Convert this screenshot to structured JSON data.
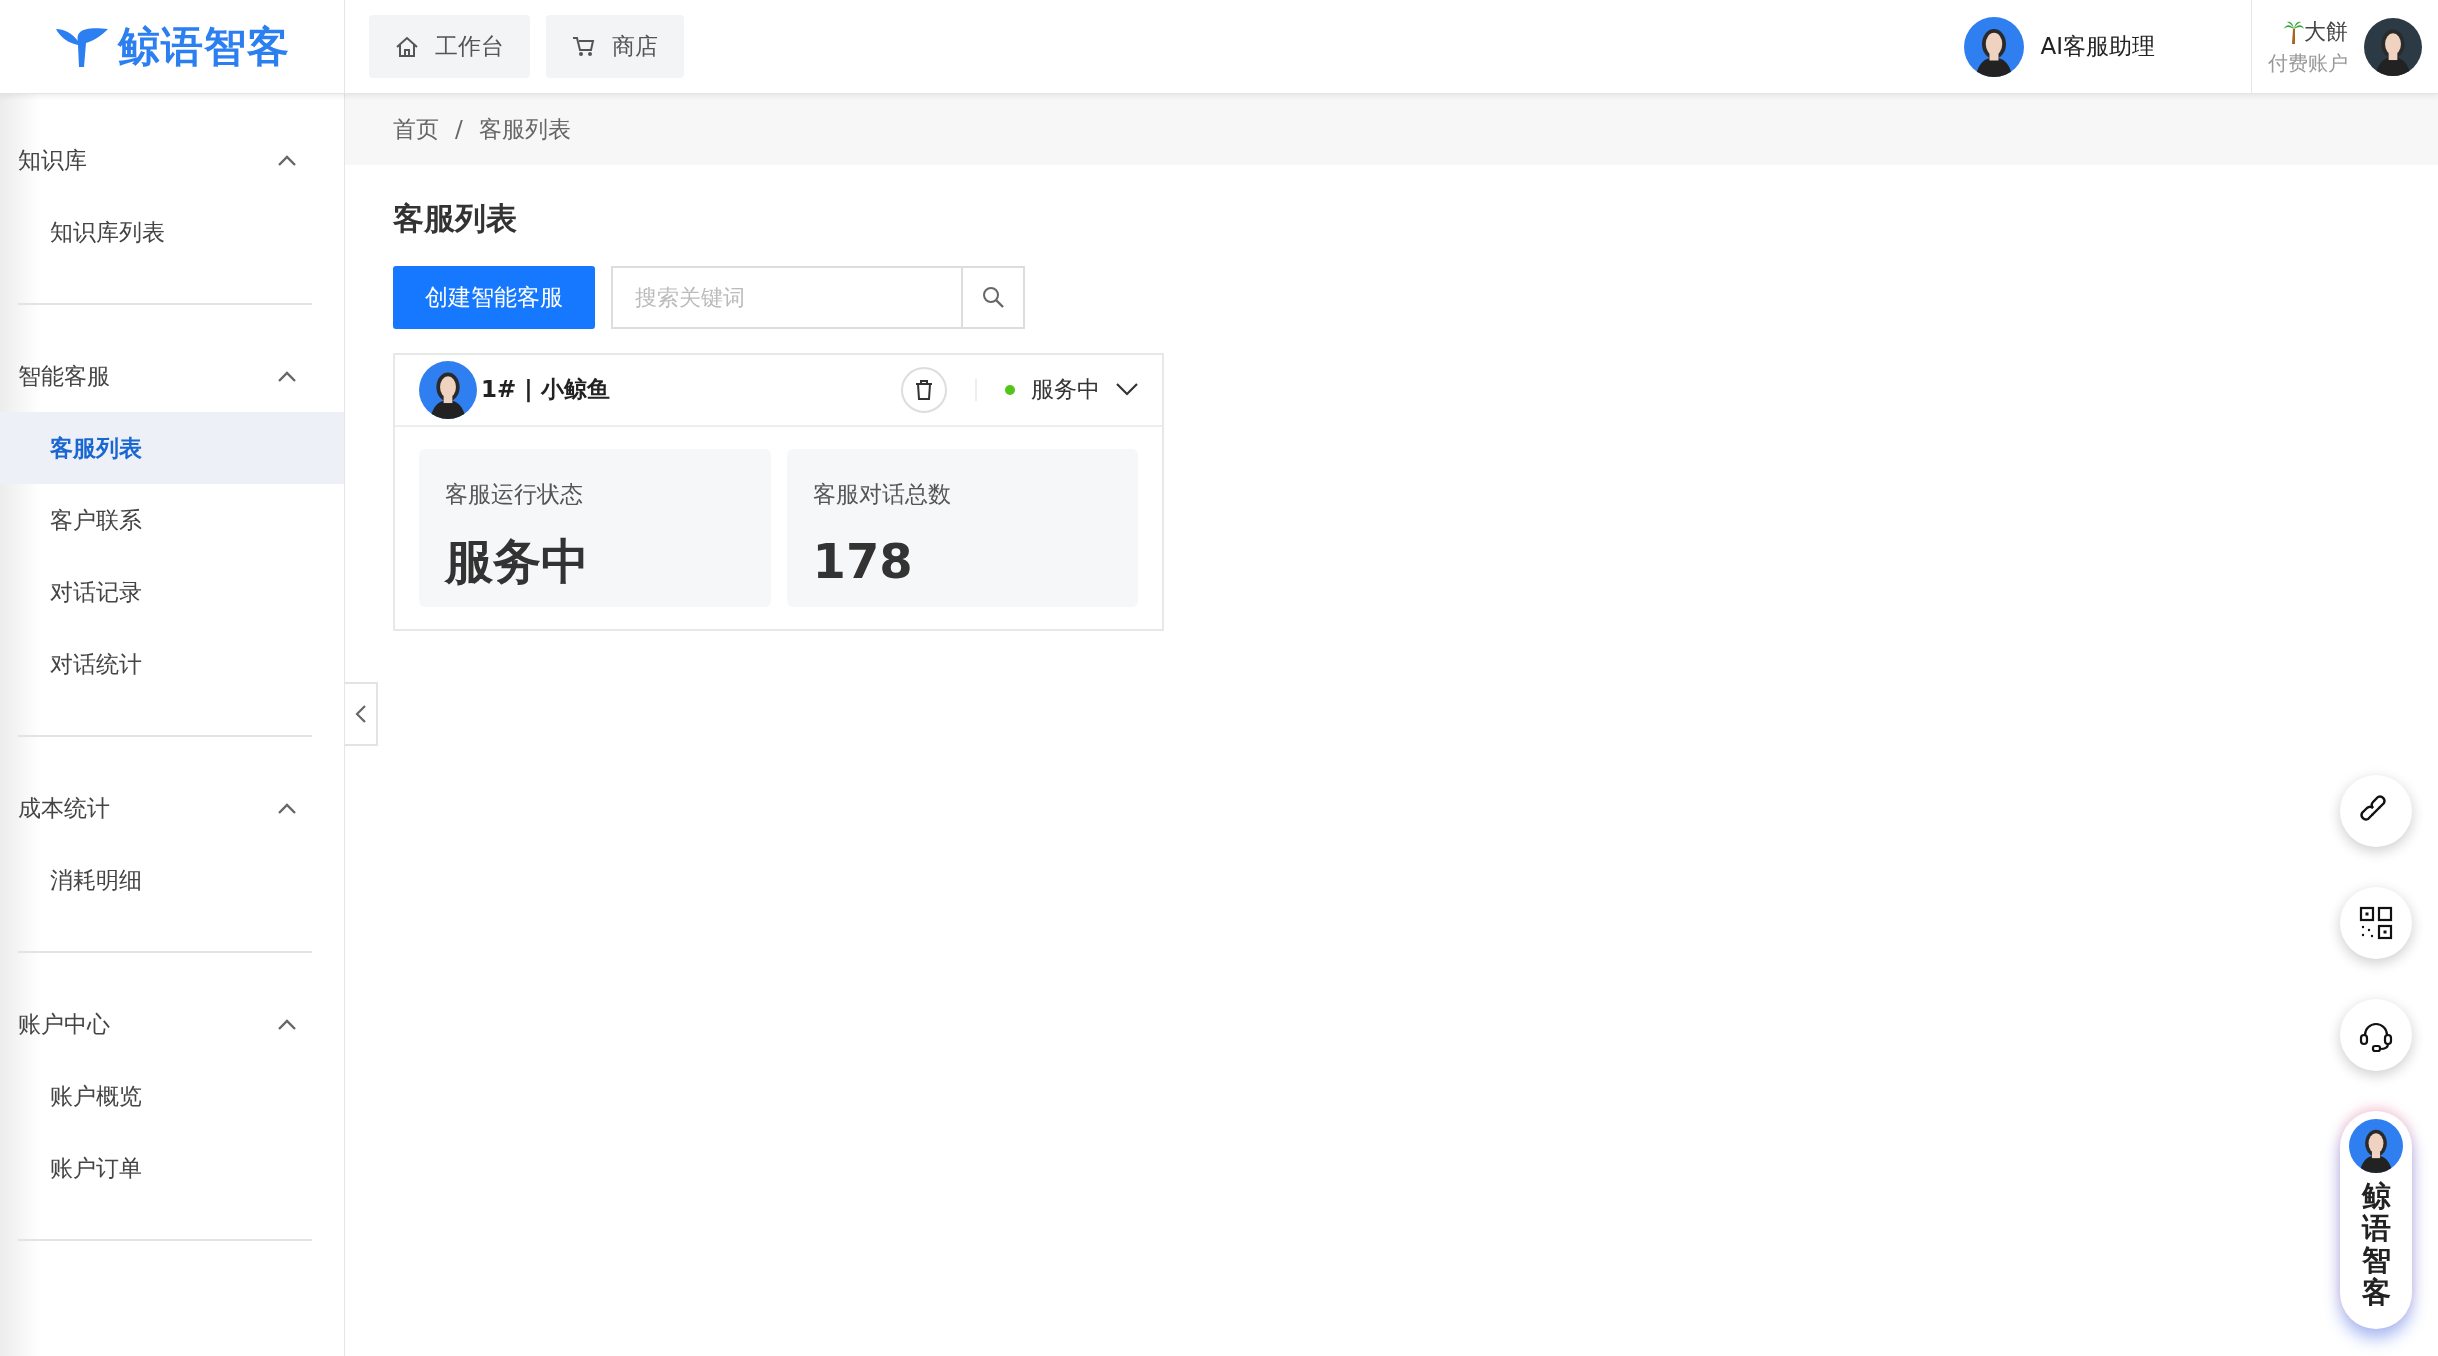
{
  "logo": {
    "text": "鲸语智客"
  },
  "top_nav": [
    {
      "label": "工作台"
    },
    {
      "label": "商店"
    }
  ],
  "assistant": {
    "label": "AI客服助理"
  },
  "user": {
    "name": "大餅",
    "plan": "付费账户"
  },
  "sidebar": {
    "groups": [
      {
        "title": "知识库",
        "expanded": true,
        "items": [
          {
            "label": "知识库列表",
            "selected": false
          }
        ]
      },
      {
        "title": "智能客服",
        "expanded": true,
        "items": [
          {
            "label": "客服列表",
            "selected": true
          },
          {
            "label": "客户联系",
            "selected": false
          },
          {
            "label": "对话记录",
            "selected": false
          },
          {
            "label": "对话统计",
            "selected": false
          }
        ]
      },
      {
        "title": "成本统计",
        "expanded": true,
        "items": [
          {
            "label": "消耗明细",
            "selected": false
          }
        ]
      },
      {
        "title": "账户中心",
        "expanded": true,
        "items": [
          {
            "label": "账户概览",
            "selected": false
          },
          {
            "label": "账户订单",
            "selected": false
          }
        ]
      }
    ]
  },
  "breadcrumb": [
    "首页",
    "客服列表"
  ],
  "breadcrumb_separator": "/",
  "page_title": "客服列表",
  "create_button": "创建智能客服",
  "search": {
    "placeholder": "搜索关键词"
  },
  "agents": [
    {
      "name": "1# | 小鲸鱼",
      "status": "服务中",
      "online": true,
      "stats": [
        {
          "label": "客服运行状态",
          "value": "服务中"
        },
        {
          "label": "客服对话总数",
          "value": "178"
        }
      ]
    }
  ],
  "float_widget": {
    "label": "鲸语智客"
  }
}
